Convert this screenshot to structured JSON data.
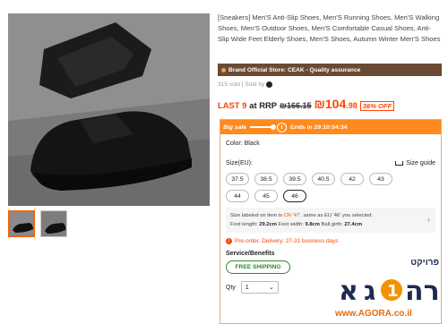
{
  "product": {
    "title": "[Sneakers] Men'S Anti-Slip Shoes, Men'S Running Shoes, Men'S Walking Shoes, Men'S Outdoor Shoes, Men'S Comfortable Casual Shoes, Anti-Slip Wide Feet Elderly Shoes, Men'S Shoes, Autumn Winter Men'S Shoes",
    "store": "Brand Official Store: CEAK - Quality assurance",
    "sold": "315 sold | Sold by",
    "stock_label": "LAST 9",
    "at_rrp": "at RRP",
    "rrp": "₪166.15",
    "price_main": "₪104",
    "price_cents": ".98",
    "discount": "36% OFF"
  },
  "sale": {
    "label": "Big sale",
    "ends": "Ends in 29:10:04:34"
  },
  "options": {
    "color_label": "Color: Black",
    "size_label": "Size(EU):",
    "size_guide": "Size guide",
    "sizes": [
      "37.5",
      "38.5",
      "39.5",
      "40.5",
      "42",
      "43",
      "44",
      "45",
      "46"
    ],
    "selected_size": "46"
  },
  "size_info": {
    "line1_pre": "Size labeled on item is ",
    "line1_cn": "CN '47'",
    "line1_post": ", same as EU '46' you selected.",
    "foot_length_label": "Foot length: ",
    "foot_length": "29.2cm",
    "foot_width_label": " Foot width: ",
    "foot_width": "9.8cm",
    "ball_girth_label": " Ball girth: ",
    "ball_girth": "27.4cm"
  },
  "delivery": {
    "preorder": "Pre-order. Delivery: 27-31 business days"
  },
  "service": {
    "label": "Service/Benefits",
    "free_shipping": "FREE SHIPPING"
  },
  "quantity": {
    "label": "Qty",
    "value": "1"
  },
  "watermark": {
    "project": "פרויקט",
    "logo_text": "אגורה",
    "site": "www.AGORA.co.il"
  },
  "colors": {
    "accent": "#ff4500",
    "sale_bar": "#ff8a1e",
    "store_bar": "#6b4a33",
    "free_shipping": "#2a8a2a"
  }
}
